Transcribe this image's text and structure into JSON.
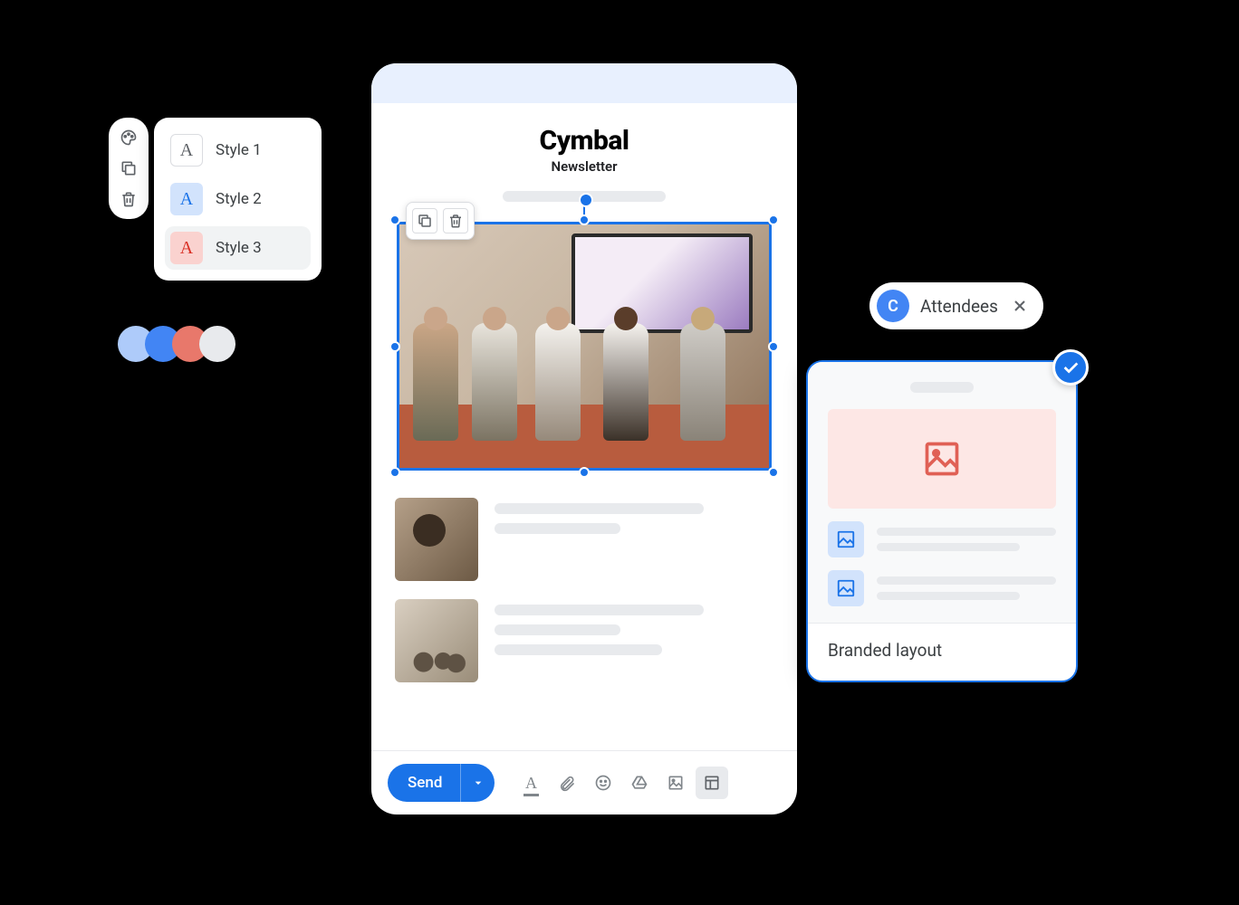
{
  "style_picker": {
    "styles": [
      {
        "label": "Style 1"
      },
      {
        "label": "Style 2"
      },
      {
        "label": "Style 3"
      }
    ]
  },
  "palette_colors": [
    "#aecbfa",
    "#4285f4",
    "#e8786b",
    "#e8eaed"
  ],
  "compose": {
    "brand": "Cymbal",
    "subtitle": "Newsletter",
    "send_label": "Send"
  },
  "chip": {
    "avatar_initial": "C",
    "label": "Attendees"
  },
  "layout_card": {
    "title": "Branded layout"
  }
}
